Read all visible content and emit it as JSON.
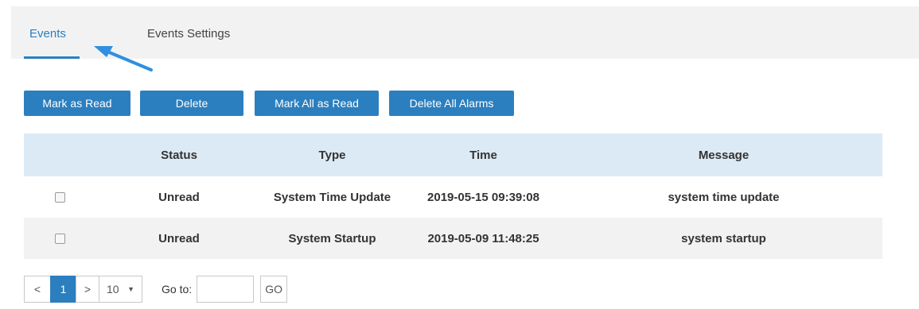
{
  "tabs": [
    {
      "label": "Events",
      "active": true
    },
    {
      "label": "Events Settings",
      "active": false
    }
  ],
  "toolbar": {
    "mark_read": "Mark as Read",
    "delete": "Delete",
    "mark_all_read": "Mark All as Read",
    "delete_all": "Delete All Alarms"
  },
  "table": {
    "headers": [
      "",
      "Status",
      "Type",
      "Time",
      "Message"
    ],
    "rows": [
      {
        "checked": false,
        "status": "Unread",
        "type": "System Time Update",
        "time": "2019-05-15 09:39:08",
        "message": "system time update"
      },
      {
        "checked": false,
        "status": "Unread",
        "type": "System Startup",
        "time": "2019-05-09 11:48:25",
        "message": "system startup"
      }
    ]
  },
  "pagination": {
    "prev": "<",
    "current_page": "1",
    "next": ">",
    "page_size": "10",
    "goto_label": "Go to:",
    "goto_value": "",
    "go_button": "GO"
  },
  "colors": {
    "accent": "#2b7fbf",
    "header_bg": "#dceaf5",
    "tabbar_bg": "#f2f2f2",
    "annotation_arrow": "#2f8fe0"
  }
}
